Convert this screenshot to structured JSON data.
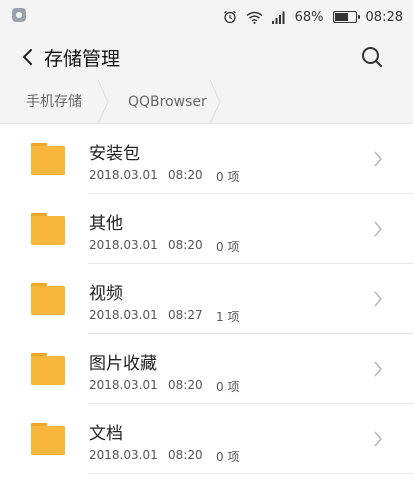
{
  "status_bar": {
    "app_icon": "app-notification-icon",
    "alarm_icon": "alarm-icon",
    "wifi_icon": "wifi-icon",
    "signal_icon": "signal-icon",
    "battery_percent_label": "68%",
    "battery_level": 0.68,
    "time": "08:28"
  },
  "header": {
    "back_icon": "back-chevron-icon",
    "title": "存储管理",
    "search_icon": "search-icon"
  },
  "breadcrumb": {
    "items": [
      "手机存储",
      "QQBrowser"
    ]
  },
  "folders": [
    {
      "name": "安装包",
      "date": "2018.03.01",
      "time": "08:20",
      "count": "0 项"
    },
    {
      "name": "其他",
      "date": "2018.03.01",
      "time": "08:20",
      "count": "0 项"
    },
    {
      "name": "视频",
      "date": "2018.03.01",
      "time": "08:27",
      "count": "1 项"
    },
    {
      "name": "图片收藏",
      "date": "2018.03.01",
      "time": "08:20",
      "count": "0 项"
    },
    {
      "name": "文档",
      "date": "2018.03.01",
      "time": "08:20",
      "count": "0 项"
    }
  ],
  "colors": {
    "folder": "#f6b73c",
    "folder_tab": "#efa72a",
    "bar_background": "#f4f4f4"
  }
}
